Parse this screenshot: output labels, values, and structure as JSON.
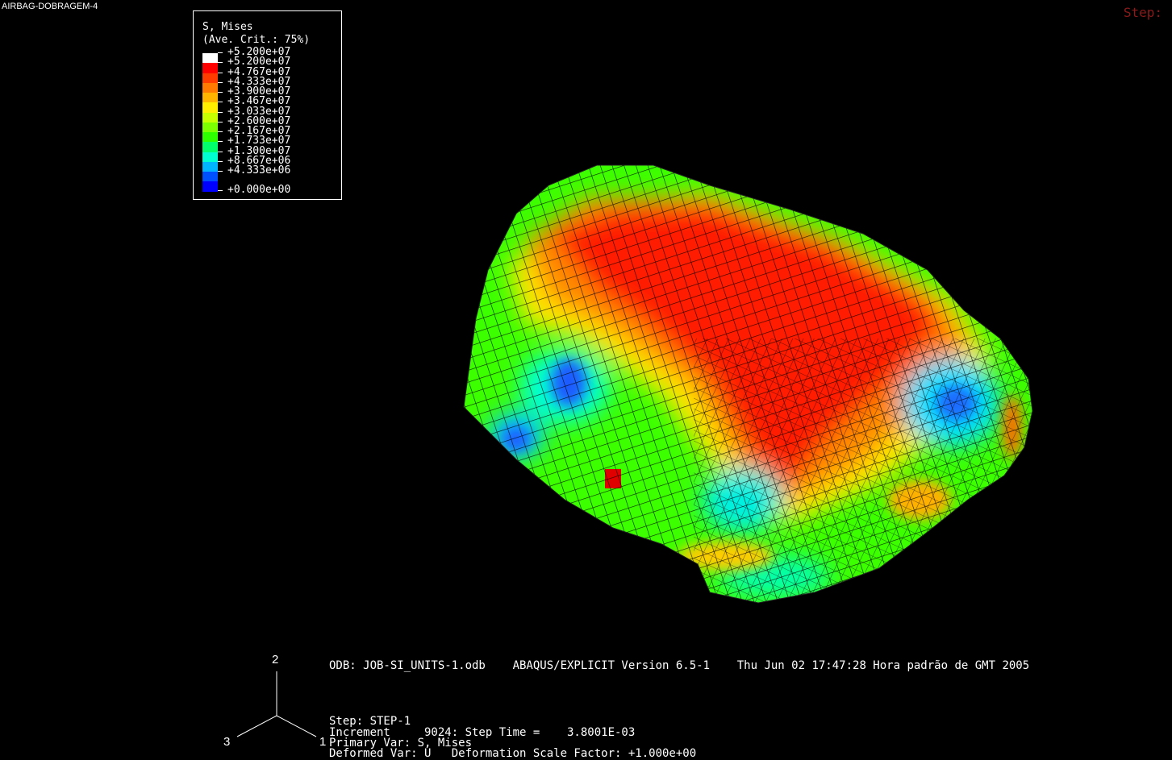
{
  "window": {
    "title": "AIRBAG-DOBRAGEM-4",
    "step_label": "Step:"
  },
  "legend": {
    "title_line1": "S, Mises",
    "title_line2": "(Ave. Crit.: 75%)",
    "entries": [
      {
        "label": "+5.200e+07",
        "color": "#ffffff"
      },
      {
        "label": "+5.200e+07",
        "color": "#ff0000"
      },
      {
        "label": "+4.767e+07",
        "color": "#ff3c00"
      },
      {
        "label": "+4.333e+07",
        "color": "#ff7a00"
      },
      {
        "label": "+3.900e+07",
        "color": "#ffb400"
      },
      {
        "label": "+3.467e+07",
        "color": "#ffee00"
      },
      {
        "label": "+3.033e+07",
        "color": "#c8ff00"
      },
      {
        "label": "+2.600e+07",
        "color": "#7cff00"
      },
      {
        "label": "+2.167e+07",
        "color": "#2eff00"
      },
      {
        "label": "+1.733e+07",
        "color": "#00ff6a"
      },
      {
        "label": "+1.300e+07",
        "color": "#00ffd0"
      },
      {
        "label": "+8.667e+06",
        "color": "#00b4ff"
      },
      {
        "label": "+4.333e+06",
        "color": "#0050ff"
      },
      {
        "label": "",
        "color": "#0000ff"
      }
    ],
    "min_label": "+0.000e+00"
  },
  "triad": {
    "axis1": "1",
    "axis2": "2",
    "axis3": "3"
  },
  "info": {
    "odb_line": "ODB: JOB-SI_UNITS-1.odb    ABAQUS/EXPLICIT Version 6.5-1    Thu Jun 02 17:47:28 Hora padrão de GMT 2005",
    "step_line": "Step: STEP-1",
    "increment_line": "Increment     9024: Step Time =    3.8001E-03",
    "primary_line": "Primary Var: S, Mises",
    "deformed_line": "Deformed Var: U   Deformation Scale Factor: +1.000e+00"
  },
  "colors": {
    "background": "#000000",
    "mesh_lines": "#000000",
    "step_label": "#8b1a1a"
  }
}
